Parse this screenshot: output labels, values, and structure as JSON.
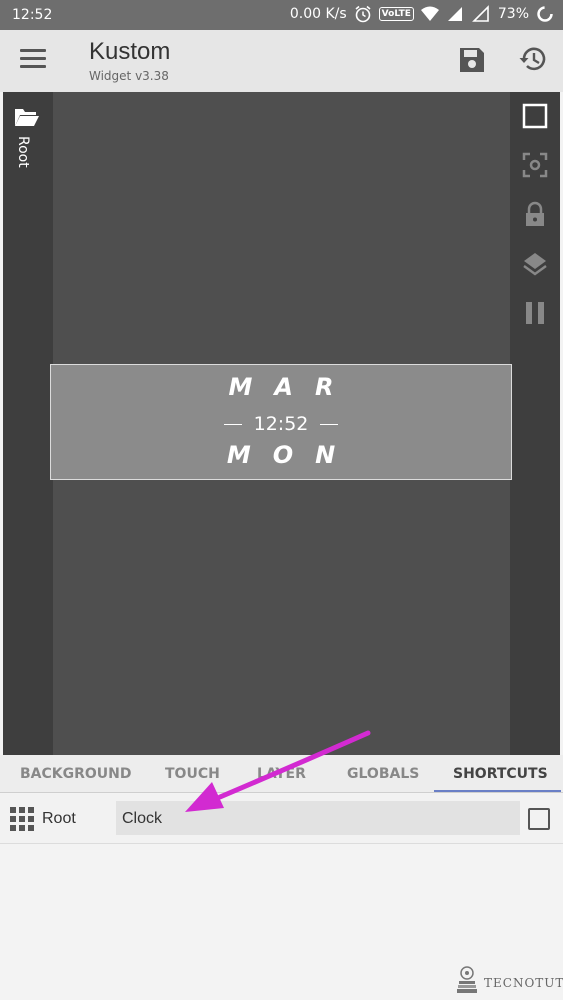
{
  "status_bar": {
    "time": "12:52",
    "speed": "0.00 K/s",
    "volte": "VoLTE",
    "battery": "73%"
  },
  "app_bar": {
    "title": "Kustom",
    "subtitle": "Widget v3.38"
  },
  "editor": {
    "root_label": "Root",
    "widget": {
      "month": "MAR",
      "time": "12:52",
      "day": "MON"
    }
  },
  "tabs": [
    {
      "label": "BACKGROUND"
    },
    {
      "label": "TOUCH"
    },
    {
      "label": "LAYER"
    },
    {
      "label": "GLOBALS"
    },
    {
      "label": "SHORTCUTS"
    }
  ],
  "active_tab": "SHORTCUTS",
  "breadcrumb": {
    "root": "Root",
    "field_value": "Clock"
  },
  "watermark": "TECNOTUTO",
  "colors": {
    "status_bar": "#6e6e6e",
    "app_bar": "#e6e6e6",
    "canvas": "#4f4f4f",
    "widget": "#8b8b8b",
    "tab_indicator": "#6a7fc6",
    "annotation_arrow": "#d22ad1"
  }
}
